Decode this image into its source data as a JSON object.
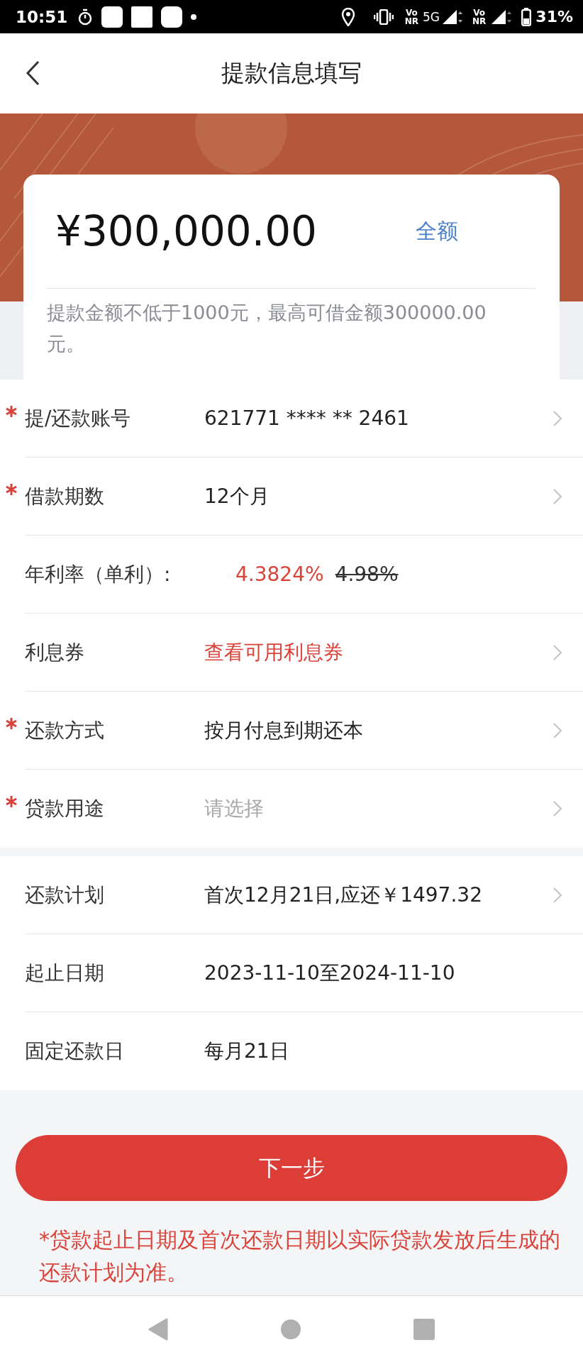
{
  "status_bar": {
    "time": "10:51",
    "network": "5G",
    "vonr": [
      {
        "top": "Vo",
        "bottom": "NR"
      },
      {
        "top": "Vo",
        "bottom": "NR"
      }
    ],
    "battery": "31%"
  },
  "header": {
    "title": "提款信息填写"
  },
  "amount_card": {
    "amount": "¥300,000.00",
    "full_amount_link": "全额",
    "hint": "提款金额不低于1000元，最高可借金额300000.00元。"
  },
  "form_rows": [
    {
      "kind": "value",
      "required": true,
      "label": "提/还款账号",
      "value": "621771 **** ** 2461",
      "has_arrow": true
    },
    {
      "kind": "value",
      "required": true,
      "label": "借款期数",
      "value": "12个月",
      "has_arrow": true
    },
    {
      "kind": "rate",
      "required": false,
      "label": "年利率（单利）:",
      "value": "4.3824%",
      "original_value": "4.98%",
      "has_arrow": false
    },
    {
      "kind": "accent",
      "required": false,
      "label": "利息券",
      "value": "查看可用利息券",
      "has_arrow": true
    },
    {
      "kind": "value",
      "required": true,
      "label": "还款方式",
      "value": "按月付息到期还本",
      "has_arrow": true
    },
    {
      "kind": "placeholder",
      "required": true,
      "label": "贷款用途",
      "placeholder": "请选择",
      "has_arrow": true
    }
  ],
  "plan_rows": [
    {
      "kind": "value",
      "required": false,
      "label": "还款计划",
      "value": "首次12月21日,应还￥1497.32",
      "has_arrow": true
    },
    {
      "kind": "value",
      "required": false,
      "label": "起止日期",
      "value": "2023-11-10至2024-11-10",
      "has_arrow": false
    },
    {
      "kind": "value",
      "required": false,
      "label": "固定还款日",
      "value": "每月21日",
      "has_arrow": false
    }
  ],
  "next_button": "下一步",
  "note": "*贷款起止日期及首次还款日期以实际贷款发放后生成的还款计划为准。"
}
